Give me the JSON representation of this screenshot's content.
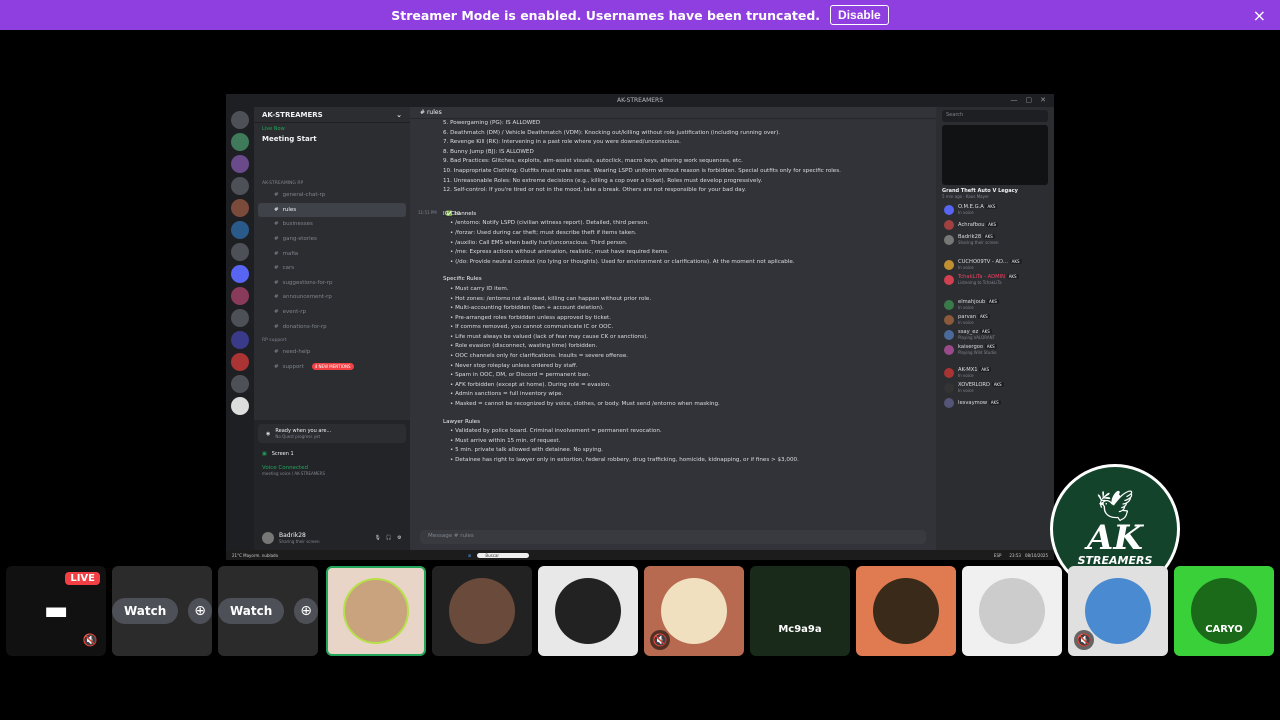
{
  "banner": {
    "text": "Streamer Mode is enabled. Usernames have been truncated.",
    "button": "Disable",
    "close_icon": "×"
  },
  "window": {
    "title": "AK-STREAMERS"
  },
  "sidebar": {
    "guild": "AK-STREAMERS",
    "event_status": "Live Now",
    "event_title": "Meeting Start",
    "categories": [
      "AK-STREAMING RP",
      "RP support"
    ],
    "channels": [
      {
        "name": "general-chat-rp"
      },
      {
        "name": "rules",
        "active": true
      },
      {
        "name": "businesses"
      },
      {
        "name": "gang-stories"
      },
      {
        "name": "mafia"
      },
      {
        "name": "cars"
      },
      {
        "name": "suggestions-for-rp"
      },
      {
        "name": "announcement-rp"
      },
      {
        "name": "event-rp"
      },
      {
        "name": "donations-for-rp"
      }
    ],
    "support_channels": [
      "need-help",
      "support"
    ],
    "mentions_pill": "4 NEW MENTIONS",
    "status_card": {
      "title": "Ready when you are...",
      "sub": "No Quest progress yet"
    },
    "screen_share": "Screen 1",
    "voice_connected": "Voice Connected",
    "voice_channel": "meeting voice / AK-STREAMERS",
    "user": {
      "name": "Badrik28",
      "status": "Sharing their screen"
    }
  },
  "chat": {
    "channel": "rules",
    "lines_top": [
      "5. Powergaming (PG): IS ALLOWED",
      "6. Deathmatch (DM) / Vehicle Deathmatch (VDM): Knocking out/killing without role justification (including running over).",
      "7. Revenge Kill (RK): Intervening in a past role where you were downed/unconscious.",
      "8. Bunny Jump (BJ): IS ALLOWED",
      "9. Bad Practices: Glitches, exploits, aim-assist visuals, autoclick, macro keys, altering work sequences, etc.",
      "10. Inappropriate Clothing: Outfits must make sense. Wearing LSPD uniform without reason is forbidden. Special outfits only for specific roles.",
      "11. Unreasonable Roles: No extreme decisions (e.g., killing a cop over a ticket). Roles must develop progressively.",
      "12. Self-control: If you're tired or not in the mood, take a break. Others are not responsible for your bad day."
    ],
    "reaction_count": "10",
    "timestamp": "11:51 PM",
    "ic_header": "IC Channels",
    "ic_lines": [
      "/entorno: Notify LSPD (civilian witness report). Detailed, third person.",
      "/forzar: Used during car theft; must describe theft if items taken.",
      "/auxilio: Call EMS when badly hurt/unconscious. Third person.",
      "/me: Express actions without animation, realistic, must have required items.",
      "(/do: Provide neutral context (no lying or thoughts). Used for environment or clarifications). At the moment not aplicable."
    ],
    "specific_header": "Specific Rules",
    "specific_lines": [
      "Must carry ID item.",
      "Hot zones: /entorno not allowed, killing can happen without prior role.",
      "Multi-accounting forbidden (ban + account deletion).",
      "Pre-arranged roles forbidden unless approved by ticket.",
      "If comms removed, you cannot communicate IC or OOC.",
      "Life must always be valued (lack of fear may cause CK or sanctions).",
      "Role evasion (disconnect, wasting time) forbidden.",
      "OOC channels only for clarifications. Insults = severe offense.",
      "Never stop roleplay unless ordered by staff.",
      "Spam in OOC, DM, or Discord = permanent ban.",
      "AFK forbidden (except at home). During role = evasion.",
      "Admin sanctions = full inventory wipe.",
      "Masked = cannot be recognized by voice, clothes, or body. Must send /entorno when masking."
    ],
    "lawyer_header": "Lawyer Rules",
    "lawyer_lines": [
      "Validated by police board. Criminal involvement = permanent revocation.",
      "Must arrive within 15 min. of request.",
      "5 min. private talk allowed with detainee. No spying.",
      "Detainee has right to lawyer only in extortion, federal robbery, drug trafficking, homicide, kidnapping, or if fines > $3,000."
    ],
    "input_placeholder": "Message # rules"
  },
  "members": {
    "search_placeholder": "Search",
    "game": {
      "title": "Grand Theft Auto V Legacy",
      "sub": "5 min ago · Kaos Mayer"
    },
    "list": [
      {
        "name": "O.M.E.G.A",
        "tag": "AKS",
        "sub": "In voice"
      },
      {
        "name": "Achrafbou",
        "tag": "AKS",
        "sub": ""
      },
      {
        "name": "Badrik28",
        "tag": "AKS",
        "sub": "Sharing their screen"
      },
      {
        "name": "CUCHO09TV - AD...",
        "tag": "AKS",
        "sub": "In voice"
      },
      {
        "name": "TchakLiTa - ADMIN",
        "tag": "AKS",
        "sub": "Listening to TchakLiTa"
      },
      {
        "name": "elmahjoub",
        "tag": "AKS",
        "sub": "In voice"
      },
      {
        "name": "parvan",
        "tag": "AKS",
        "sub": "In voice"
      },
      {
        "name": "ssay_ez",
        "tag": "AKS",
        "sub": "Playing VALORANT"
      },
      {
        "name": "kaisergoo",
        "tag": "AKS",
        "sub": "Playing Wild Studio"
      },
      {
        "name": "AK-MX1",
        "tag": "AKS",
        "sub": "In voice"
      },
      {
        "name": "XOVERLORD",
        "tag": "AKS",
        "sub": "In voice"
      },
      {
        "name": "lesvaymow",
        "tag": "AKS",
        "sub": ""
      }
    ]
  },
  "taskbar": {
    "search": "Buscar",
    "weather": "21°C Mayorm. nublado",
    "lang": "ESP",
    "time": "23:53",
    "date": "08/10/2025"
  },
  "logo": {
    "main": "AK",
    "sub": "STREAMERS"
  },
  "tiles": {
    "live_label": "LIVE",
    "watch_label": "Watch",
    "caryo_label": "CARYO",
    "mc_label": "Mc9a9a"
  }
}
